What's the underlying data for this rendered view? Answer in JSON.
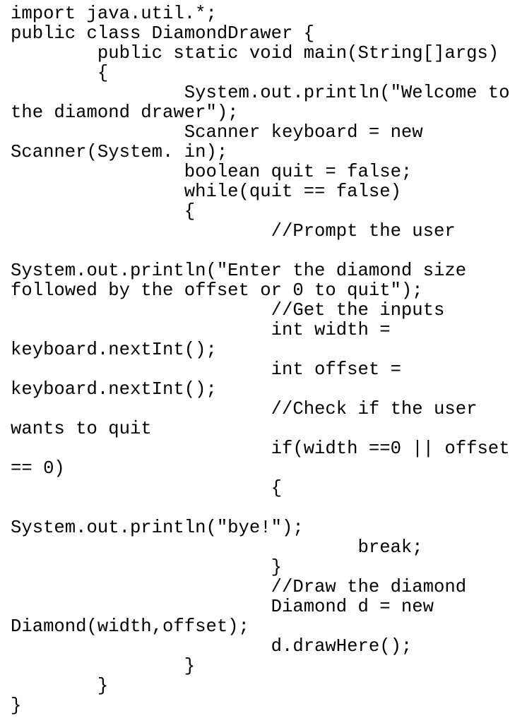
{
  "document": {
    "kind": "plain-text-source-code-listing",
    "language": "Java",
    "class_name": "DiamondDrawer",
    "background_color": "#ffffff",
    "text_color": "#000000",
    "font_style": "monospace",
    "wrap_columns": 47,
    "line_count": 25,
    "code_lines": [
      "import java.util.*;",
      "public class DiamondDrawer {",
      "        public static void main(String[]args)",
      "        {",
      "                System.out.println(\"Welcome to the diamond drawer\");",
      "                Scanner keyboard = new Scanner(System. in);",
      "                boolean quit = false;",
      "                while(quit == false)",
      "                {",
      "                        //Prompt the user",
      "                        System.out.println(\"Enter the diamond size followed by the offset or 0 to quit\");",
      "                        //Get the inputs",
      "                        int width = keyboard.nextInt();",
      "                        int offset = keyboard.nextInt();",
      "                        //Check if the user wants to quit",
      "                        if(width ==0 || offset == 0)",
      "                        {",
      "                                System.out.println(\"bye!\");",
      "                                break;",
      "                        }",
      "                        //Draw the diamond",
      "                        Diamond d = new Diamond(width,offset);",
      "                        d.drawHere();",
      "                }",
      "        }",
      "}"
    ],
    "full_text": "import java.util.*;\npublic class DiamondDrawer {\n        public static void main(String[]args)\n        {\n                System.out.println(\"Welcome to the diamond drawer\");\n                Scanner keyboard = new Scanner(System. in);\n                boolean quit = false;\n                while(quit == false)\n                {\n                        //Prompt the user\n                        System.out.println(\"Enter the diamond size followed by the offset or 0 to quit\");\n                        //Get the inputs\n                        int width = keyboard.nextInt();\n                        int offset = keyboard.nextInt();\n                        //Check if the user wants to quit\n                        if(width ==0 || offset == 0)\n                        {\n                                System.out.println(\"bye!\");\n                                break;\n                        }\n                        //Draw the diamond\n                        Diamond d = new Diamond(width,offset);\n                        d.drawHere();\n                }\n        }\n}"
  }
}
